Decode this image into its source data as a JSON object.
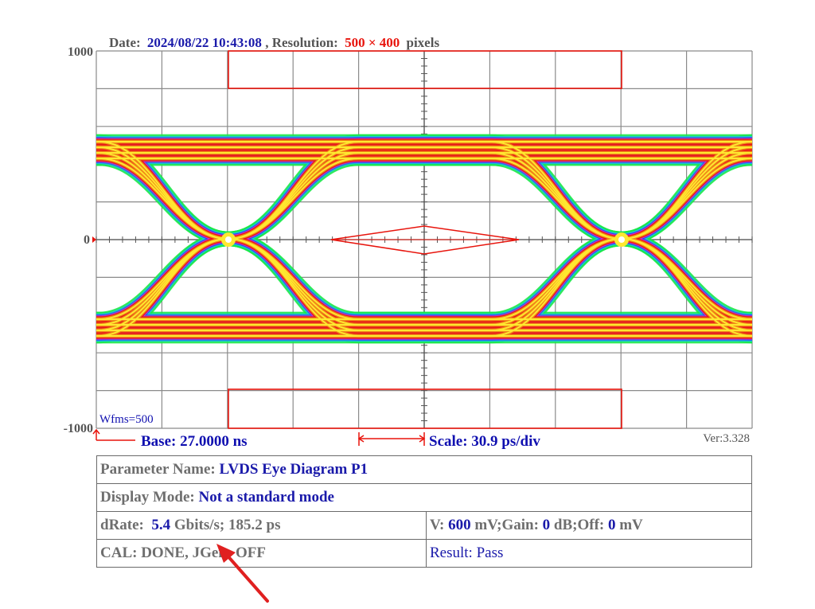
{
  "header": {
    "date_label": "Date:",
    "date_value": "2024/08/22 10:43:08",
    "res_label": ", Resolution:",
    "res_value": "500 × 400",
    "res_unit": "pixels"
  },
  "chart_data": {
    "type": "line",
    "title": "",
    "xlabel": "",
    "ylabel": "",
    "ylim": [
      -1000,
      1000
    ],
    "y_ticks": [
      "1000",
      "0",
      "-1000"
    ],
    "grid": true,
    "divisions_x": 10,
    "divisions_y": 10,
    "series": [
      {
        "values": []
      }
    ]
  },
  "plot": {
    "wfms": "Wfms=500",
    "base_label": "Base: 27.0000 ns",
    "scale_label": "Scale: 30.9 ps/div",
    "version": "Ver:3.328"
  },
  "table": {
    "param_name_label": "Parameter Name:",
    "param_name_value": "LVDS Eye Diagram P1",
    "display_mode_label": "Display Mode:",
    "display_mode_value": "Not a standard mode",
    "drate_label": "dRate:",
    "drate_value": "5.4",
    "drate_unit": "Gbits/s;",
    "drate_ps_value": "185.2",
    "drate_ps_unit": "ps",
    "v_label": "V:",
    "v_value": "600",
    "v_unit": "mV;Gain:",
    "gain_value": "0",
    "gain_unit": "dB;Off:",
    "off_value": "0",
    "off_unit": "mV",
    "cal_text": "CAL: DONE, JGen: OFF",
    "result_text": "Result: Pass"
  },
  "colors": {
    "grid": "#8a8a8a",
    "mask": "#e8140c",
    "text_blue": "#1a1aaa",
    "text_gray": "#555555"
  }
}
